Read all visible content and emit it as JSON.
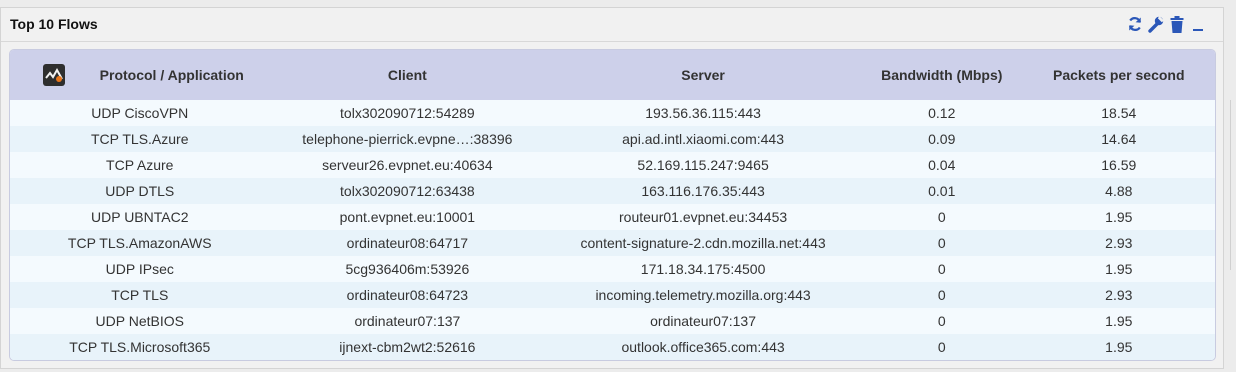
{
  "panel": {
    "title": "Top 10 Flows"
  },
  "tools": [
    {
      "name": "refresh-icon",
      "color": "#2b57b8"
    },
    {
      "name": "wrench-icon",
      "color": "#2b57b8"
    },
    {
      "name": "trash-icon",
      "color": "#2b57b8"
    },
    {
      "name": "minimize-icon",
      "color": "#2b57b8"
    }
  ],
  "table": {
    "columns": [
      "Protocol / Application",
      "Client",
      "Server",
      "Bandwidth (Mbps)",
      "Packets per second"
    ],
    "rows": [
      [
        "UDP CiscoVPN",
        "tolx302090712:54289",
        "193.56.36.115:443",
        "0.12",
        "18.54"
      ],
      [
        "TCP TLS.Azure",
        "telephone-pierrick.evpne…:38396",
        "api.ad.intl.xiaomi.com:443",
        "0.09",
        "14.64"
      ],
      [
        "TCP Azure",
        "serveur26.evpnet.eu:40634",
        "52.169.115.247:9465",
        "0.04",
        "16.59"
      ],
      [
        "UDP DTLS",
        "tolx302090712:63438",
        "163.116.176.35:443",
        "0.01",
        "4.88"
      ],
      [
        "UDP UBNTAC2",
        "pont.evpnet.eu:10001",
        "routeur01.evpnet.eu:34453",
        "0",
        "1.95"
      ],
      [
        "TCP TLS.AmazonAWS",
        "ordinateur08:64717",
        "content-signature-2.cdn.mozilla.net:443",
        "0",
        "2.93"
      ],
      [
        "UDP IPsec",
        "5cg936406m:53926",
        "171.18.34.175:4500",
        "0",
        "1.95"
      ],
      [
        "TCP TLS",
        "ordinateur08:64723",
        "incoming.telemetry.mozilla.org:443",
        "0",
        "2.93"
      ],
      [
        "UDP NetBIOS",
        "ordinateur07:137",
        "ordinateur07:137",
        "0",
        "1.95"
      ],
      [
        "TCP TLS.Microsoft365",
        "ijnext-cbm2wt2:52616",
        "outlook.office365.com:443",
        "0",
        "1.95"
      ]
    ]
  },
  "colors": {
    "header_bg": "#cdd0ea",
    "row_odd": "#f4fafe",
    "row_even": "#e8f3fa",
    "accent": "#2b57b8"
  }
}
